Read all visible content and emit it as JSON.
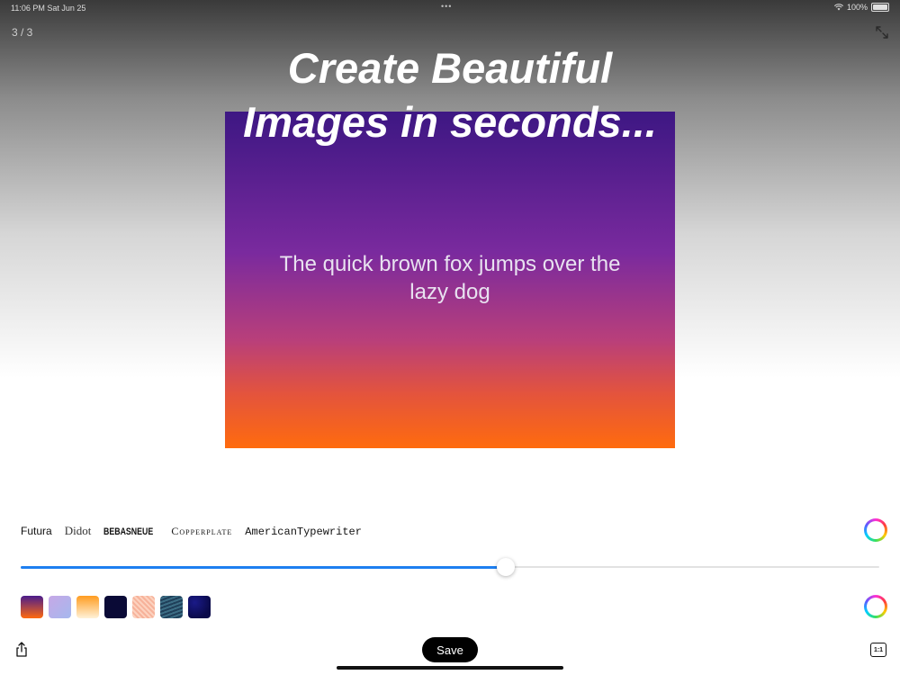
{
  "status_bar": {
    "time": "11:06 PM   Sat Jun 25",
    "dots": "•••",
    "battery_text": "100%"
  },
  "header": {
    "page_counter": "3 / 3"
  },
  "headline": {
    "line1": "Create Beautiful",
    "line2": "Images in seconds..."
  },
  "canvas": {
    "sample_text": "The quick brown fox jumps over the lazy dog",
    "gradient_colors": [
      "#3d1783",
      "#7a2a9e",
      "#b93f7a",
      "#e4543c",
      "#ff6b0e"
    ]
  },
  "fonts": {
    "options": [
      "Futura",
      "Didot",
      "BEBASNEUE",
      "Copperplate",
      "AmericanTypewriter"
    ],
    "selected": "Futura"
  },
  "slider": {
    "value_fraction": 0.565
  },
  "swatches": {
    "count": 7,
    "selected_index": 0
  },
  "toolbar": {
    "save_label": "Save",
    "ratio_label": "1:1",
    "share_icon": "share-icon"
  },
  "colors": {
    "accent": "#1e7ff0",
    "save_bg": "#000000"
  }
}
